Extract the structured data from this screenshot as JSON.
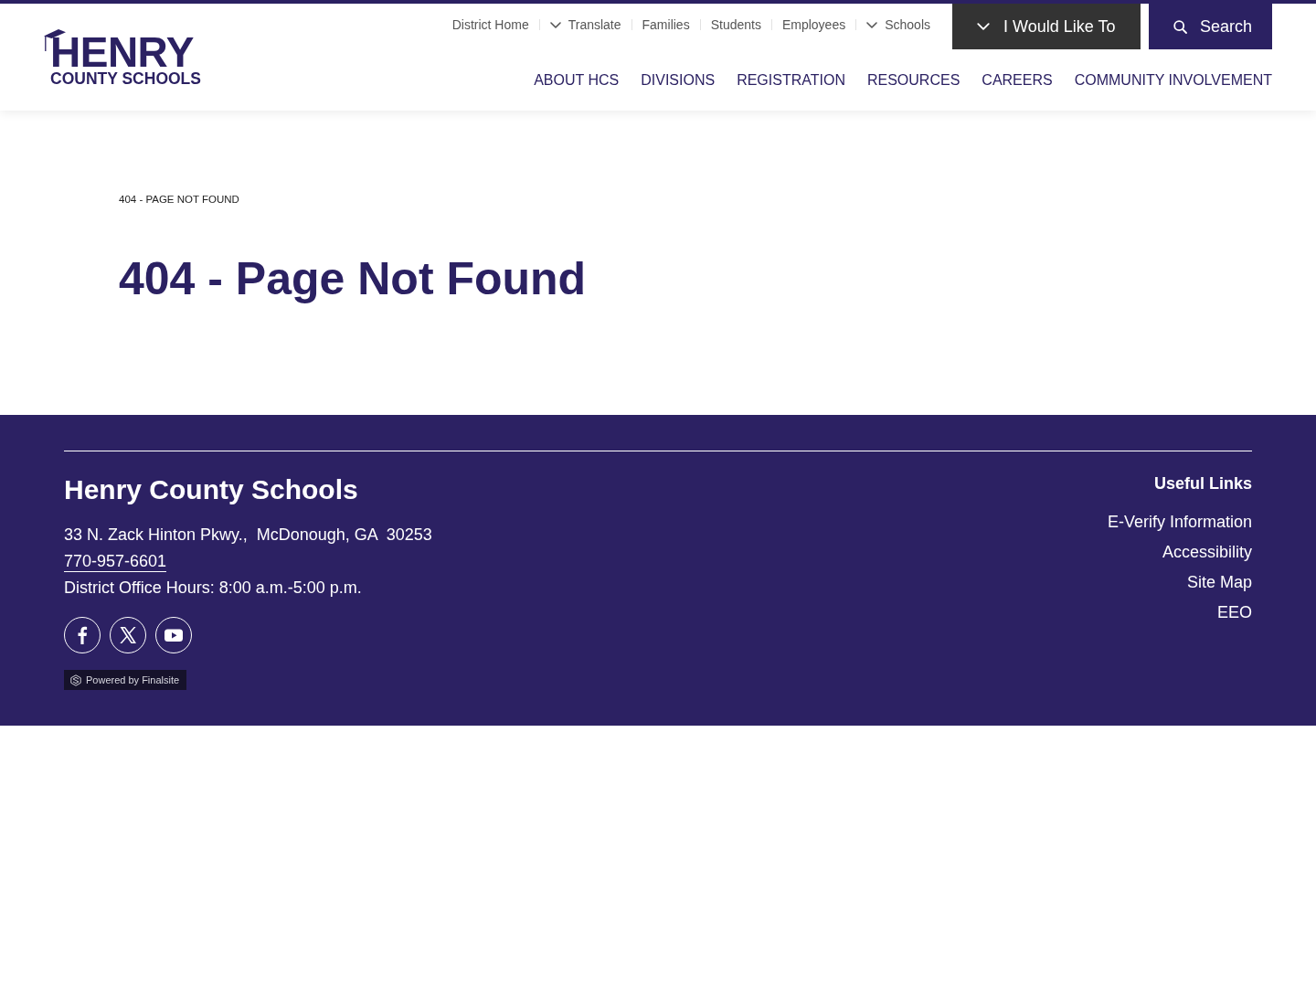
{
  "header": {
    "logo": {
      "title": "HENRY",
      "subtitle": "COUNTY SCHOOLS"
    },
    "utility_nav": [
      {
        "label": "District Home",
        "kind": "link"
      },
      {
        "label": "Translate",
        "kind": "dropdown"
      },
      {
        "label": "Families",
        "kind": "link"
      },
      {
        "label": "Students",
        "kind": "link"
      },
      {
        "label": "Employees",
        "kind": "link"
      },
      {
        "label": "Schools",
        "kind": "dropdown"
      }
    ],
    "action_buttons": [
      {
        "label": "I Would Like To",
        "kind": "menu"
      },
      {
        "label": "Search",
        "kind": "search"
      }
    ],
    "main_nav": [
      "ABOUT HCS",
      "DIVISIONS",
      "REGISTRATION",
      "RESOURCES",
      "CAREERS",
      "COMMUNITY INVOLVEMENT"
    ]
  },
  "breadcrumb": "404 - PAGE NOT FOUND",
  "page_title": "404 - Page Not Found",
  "footer": {
    "name": "Henry County Schools",
    "address": "33 N. Zack Hinton Pkwy.,  McDonough, GA  30253",
    "phone": "770-957-6601",
    "hours": "District Office Hours: 8:00 a.m.-5:00 p.m.",
    "social": [
      {
        "kind": "facebook"
      },
      {
        "kind": "x"
      },
      {
        "kind": "youtube"
      }
    ],
    "badge": "Powered by Finalsite",
    "links_heading": "Useful Links",
    "links": [
      "E-Verify Information",
      "Accessibility",
      "Site Map",
      "EEO"
    ]
  }
}
